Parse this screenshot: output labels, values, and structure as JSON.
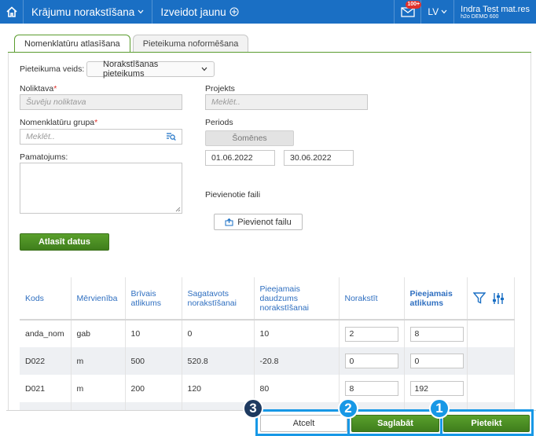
{
  "topbar": {
    "title": "Krājumu norakstīšana",
    "new_label": "Izveidot jaunu",
    "badge": "100+",
    "lang": "LV",
    "user_name": "Indra Test mat.res",
    "company": "h2o DEMO 600"
  },
  "tabs": [
    {
      "label": "Nomenklatūru atlasīšana"
    },
    {
      "label": "Pieteikuma noformēšana"
    }
  ],
  "form": {
    "request_type_label": "Pieteikuma veids:",
    "request_type_value": "Norakstīšanas pieteikums",
    "warehouse_label": "Noliktava",
    "warehouse_value": "Šuvēju noliktava",
    "project_label": "Projekts",
    "project_placeholder": "Meklēt..",
    "group_label": "Nomenklatūru grupa",
    "group_placeholder": "Meklēt..",
    "period_label": "Periods",
    "period_button": "Šomēnes",
    "date_from": "01.06.2022",
    "date_to": "30.06.2022",
    "reason_label": "Pamatojums:",
    "files_label": "Pievienotie faili",
    "add_file_button": "Pievienot failu",
    "select_button": "Atlasīt datus",
    "required_mark": "*"
  },
  "table": {
    "headers": [
      "Kods",
      "Mērvienība",
      "Brīvais atlikums",
      "Sagatavots norakstīšanai",
      "Pieejamais daudzums norakstīšanai",
      "Norakstīt",
      "Pieejamais atlikums"
    ],
    "rows": [
      [
        "anda_nom",
        "gab",
        "10",
        "0",
        "10",
        "2",
        "8"
      ],
      [
        "D022",
        "m",
        "500",
        "520.8",
        "-20.8",
        "0",
        "0"
      ],
      [
        "D021",
        "m",
        "200",
        "120",
        "80",
        "8",
        "192"
      ]
    ]
  },
  "footer": {
    "cancel": "Atcelt",
    "save": "Saglabāt",
    "submit": "Pieteikt"
  },
  "markers": [
    "3",
    "2",
    "1"
  ],
  "colors": {
    "topbar": "#1a6fc4",
    "accent_green": "#4a8c24",
    "highlight": "#1798e6"
  }
}
